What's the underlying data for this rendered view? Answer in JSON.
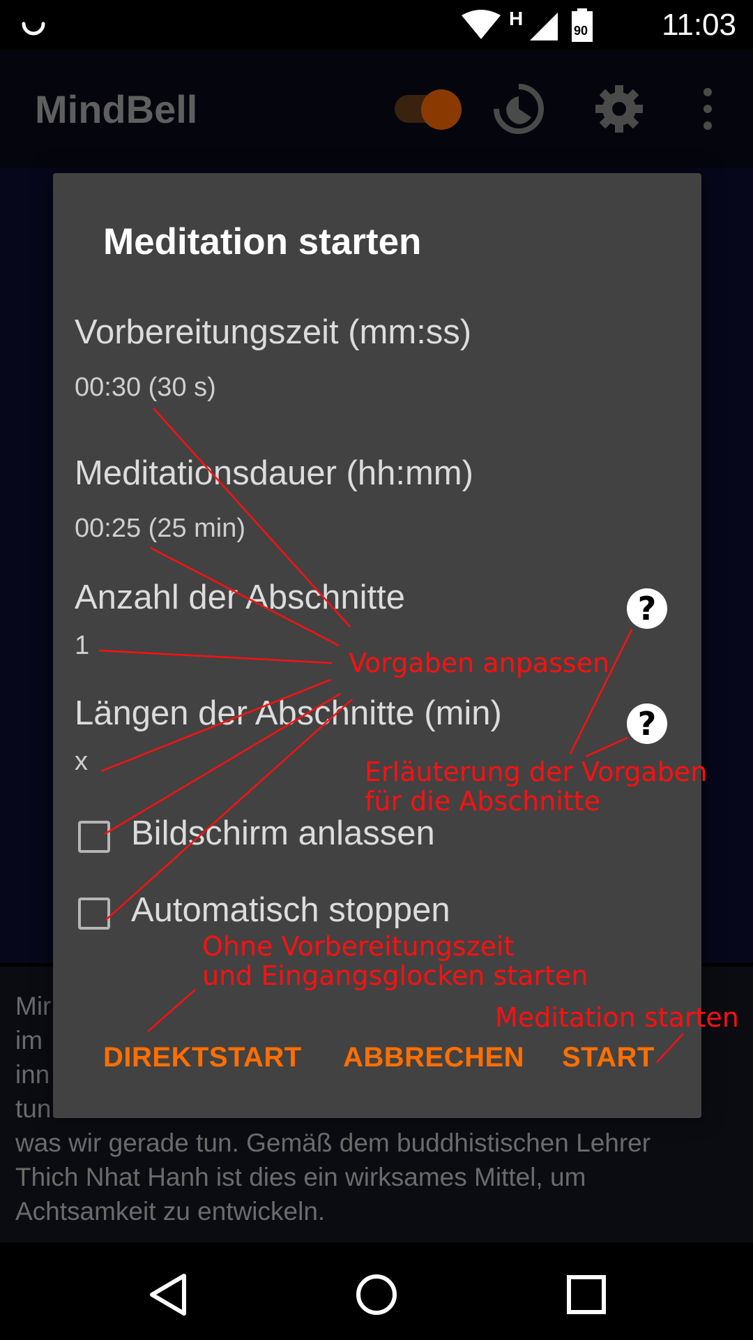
{
  "status_bar": {
    "time": "11:03",
    "battery_level": "90",
    "network_type": "H",
    "icons": [
      "spinner-icon",
      "wifi-icon",
      "signal-icon",
      "battery-icon"
    ]
  },
  "app_bar": {
    "title": "MindBell",
    "icons": [
      "toggle-switch",
      "meditation-timer-icon",
      "gear-icon",
      "overflow-menu-icon"
    ]
  },
  "background_text": {
    "lines": [
      "Mir",
      "im",
      "inn",
      "tun",
      "was wir gerade tun. Gemäß dem buddhistischen Lehrer",
      "Thich Nhat Hanh ist dies ein wirksames Mittel, um",
      "Achtsamkeit zu entwickeln."
    ]
  },
  "dialog": {
    "title": "Meditation starten",
    "preferences": [
      {
        "title": "Vorbereitungszeit (mm:ss)",
        "value": "00:30 (30 s)"
      },
      {
        "title": "Meditationsdauer (hh:mm)",
        "value": "00:25 (25 min)"
      },
      {
        "title": "Anzahl der Abschnitte",
        "value": "1"
      },
      {
        "title": "Längen der Abschnitte (min)",
        "value": "x"
      }
    ],
    "checkboxes": [
      {
        "label": "Bildschirm anlassen",
        "checked": false
      },
      {
        "label": "Automatisch stoppen",
        "checked": false
      }
    ],
    "help_icon_glyph": "?",
    "buttons": {
      "direct_start": "DIREKTSTART",
      "cancel": "ABBRECHEN",
      "start": "START"
    }
  },
  "annotations": {
    "adjust_defaults": "Vorgaben anpassen",
    "explanation_line1": "Erläuterung der Vorgaben",
    "explanation_line2": "für die Abschnitte",
    "direct_start_line1": "Ohne Vorbereitungszeit",
    "direct_start_line2": "und Eingangsglocken starten",
    "start_meditation": "Meditation starten",
    "color": "#ff1010"
  },
  "colors": {
    "accent": "#ff6f00",
    "dialog_bg": "#424242",
    "annotation": "#ff1010"
  },
  "nav_bar": {
    "icons": [
      "back-icon",
      "home-icon",
      "recents-icon"
    ]
  }
}
